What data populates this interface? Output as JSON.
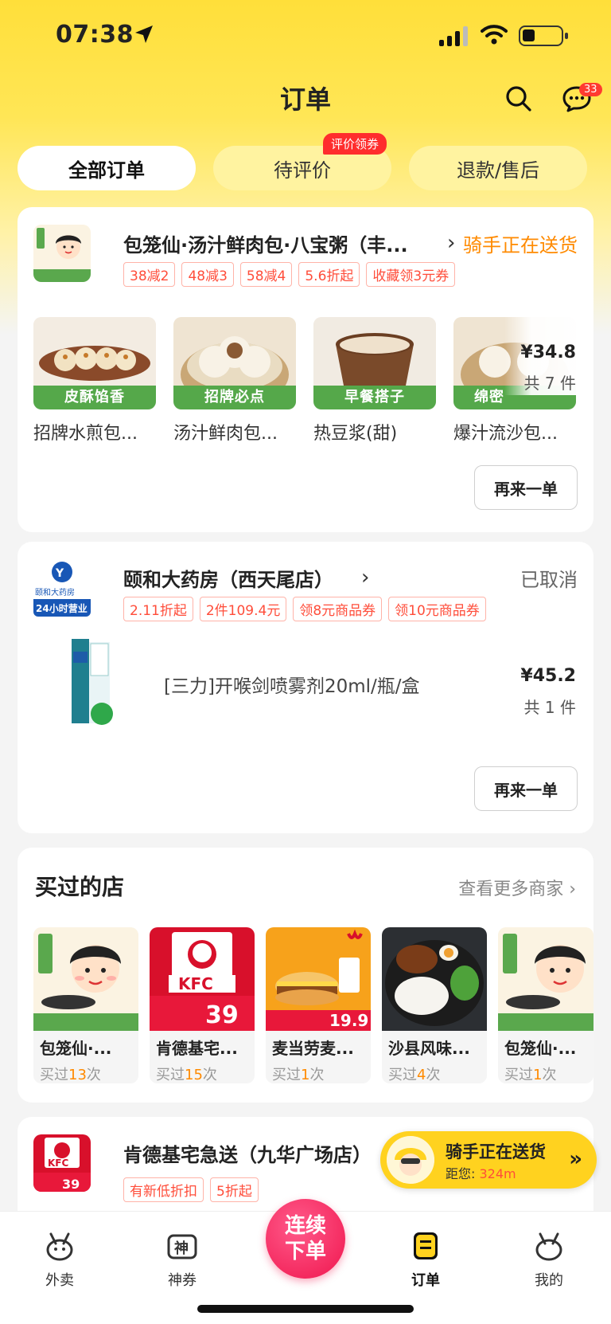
{
  "status_bar": {
    "time": "07:38"
  },
  "header": {
    "title": "订单",
    "message_badge": "33"
  },
  "tabs": [
    {
      "label": "全部订单"
    },
    {
      "label": "待评价",
      "badge": "评价领券"
    },
    {
      "label": "退款/售后"
    }
  ],
  "order1": {
    "shop_name": "包笼仙·汤汁鲜肉包·八宝粥（丰...",
    "status": "骑手正在送货",
    "promos": [
      "38减2",
      "48减3",
      "58减4",
      "5.6折起",
      "收藏领3元券"
    ],
    "items": [
      {
        "name": "招牌水煎包...",
        "tag": "皮酥馅香"
      },
      {
        "name": "汤汁鲜肉包...",
        "tag": "招牌必点"
      },
      {
        "name": "热豆浆(甜)",
        "tag": "早餐搭子"
      },
      {
        "name": "爆汁流沙包...",
        "tag": "绵密"
      }
    ],
    "price": "¥34.8",
    "count": "共 7 件",
    "again_label": "再来一单"
  },
  "order2": {
    "shop_name": "颐和大药房（西天尾店）",
    "status": "已取消",
    "promos": [
      "2.11折起",
      "2件109.4元",
      "领8元商品券",
      "领10元商品券"
    ],
    "item_name": "[三力]开喉剑喷雾剂20ml/瓶/盒",
    "price": "¥45.2",
    "count": "共 1 件",
    "again_label": "再来一单"
  },
  "bought": {
    "title": "买过的店",
    "more_label": "查看更多商家",
    "stores": [
      {
        "name": "包笼仙·...",
        "prefix": "买过",
        "count": "13",
        "suffix": "次"
      },
      {
        "name": "肯德基宅...",
        "prefix": "买过",
        "count": "15",
        "suffix": "次"
      },
      {
        "name": "麦当劳麦...",
        "prefix": "买过",
        "count": "1",
        "suffix": "次"
      },
      {
        "name": "沙县风味...",
        "prefix": "买过",
        "count": "4",
        "suffix": "次"
      },
      {
        "name": "包笼仙·...",
        "prefix": "买过",
        "count": "1",
        "suffix": "次"
      }
    ]
  },
  "order3": {
    "shop_name": "肯德基宅急送（九华广场店）",
    "promos": [
      "有新低折扣",
      "5折起"
    ]
  },
  "rider": {
    "title": "骑手正在送货",
    "distance_label": "距您:",
    "distance": "324m"
  },
  "bottom_nav": {
    "items": [
      "外卖",
      "神券",
      "订单",
      "我的"
    ],
    "center_line1": "连续",
    "center_line2": "下单"
  },
  "colors": {
    "brand_yellow": "#ffd21f",
    "accent_orange": "#ff8a00",
    "promo_red": "#ff4d3a"
  }
}
